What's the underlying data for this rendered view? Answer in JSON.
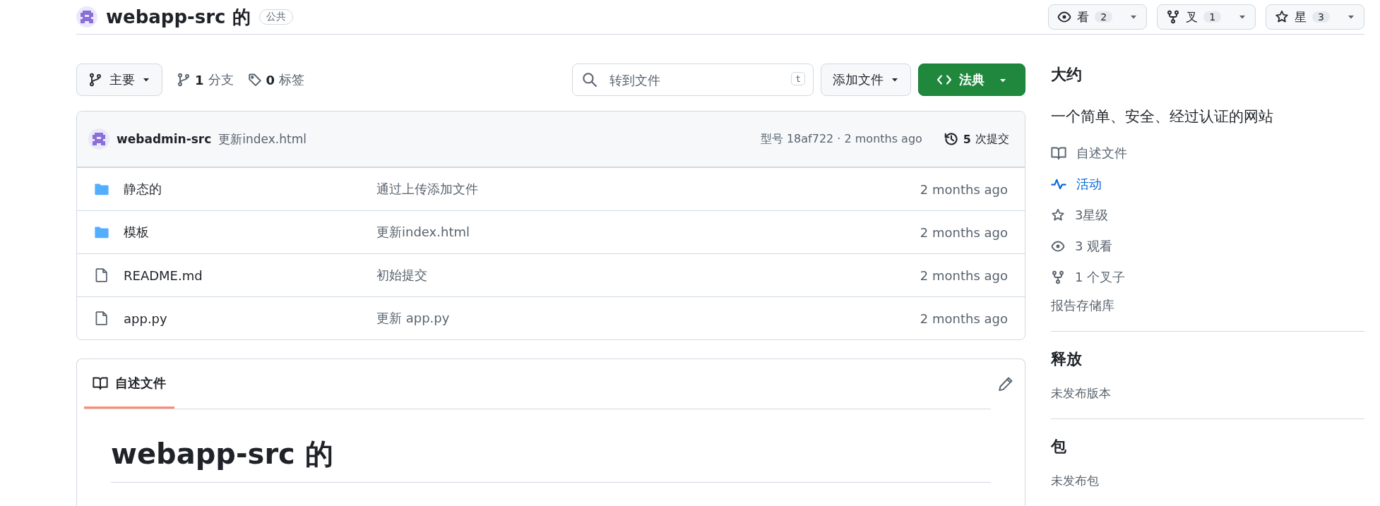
{
  "repo": {
    "name": "webapp-src 的",
    "visibility": "公共"
  },
  "repo_actions": [
    {
      "kind": "watch",
      "label": "看",
      "count": "2"
    },
    {
      "kind": "fork",
      "label": "叉",
      "count": "1"
    },
    {
      "kind": "star",
      "label": "星",
      "count": "3"
    }
  ],
  "toolbar": {
    "branch": "主要",
    "branches": {
      "count": "1",
      "label": "分支"
    },
    "tags": {
      "count": "0",
      "label": "标签"
    },
    "search": {
      "placeholder": "转到文件",
      "shortcut": "t"
    },
    "add_file": "添加文件",
    "code": "法典"
  },
  "commit": {
    "author": "webadmin-src",
    "message": "更新index.html",
    "meta": "型号 18af722 · 2 months ago",
    "commits": {
      "count": "5",
      "label": "次提交"
    }
  },
  "files": [
    {
      "kind": "folder",
      "name": "静态的",
      "message": "通过上传添加文件",
      "time": "2 months ago"
    },
    {
      "kind": "folder",
      "name": "模板",
      "message": "更新index.html",
      "time": "2 months ago"
    },
    {
      "kind": "file",
      "name": "README.md",
      "message": "初始提交",
      "time": "2 months ago"
    },
    {
      "kind": "file",
      "name": "app.py",
      "message": "更新 app.py",
      "time": "2 months ago"
    }
  ],
  "readme": {
    "tab": {
      "label": "自述文件",
      "selected": true
    },
    "heading": "webapp-src 的"
  },
  "sidebar": {
    "about": {
      "title": "大约",
      "description": "一个简单、安全、经过认证的网站",
      "links": [
        {
          "kind": "readme",
          "label": "自述文件"
        },
        {
          "kind": "activity",
          "label": "活动"
        },
        {
          "kind": "stars",
          "label": "3星级"
        },
        {
          "kind": "watchers",
          "label": "3 观看"
        },
        {
          "kind": "forks",
          "label": "1 个叉子"
        },
        {
          "kind": "report",
          "label": "报告存储库"
        }
      ]
    },
    "releases": {
      "title": "释放",
      "text": "未发布版本"
    },
    "packages": {
      "title": "包",
      "text": "未发布包"
    }
  }
}
